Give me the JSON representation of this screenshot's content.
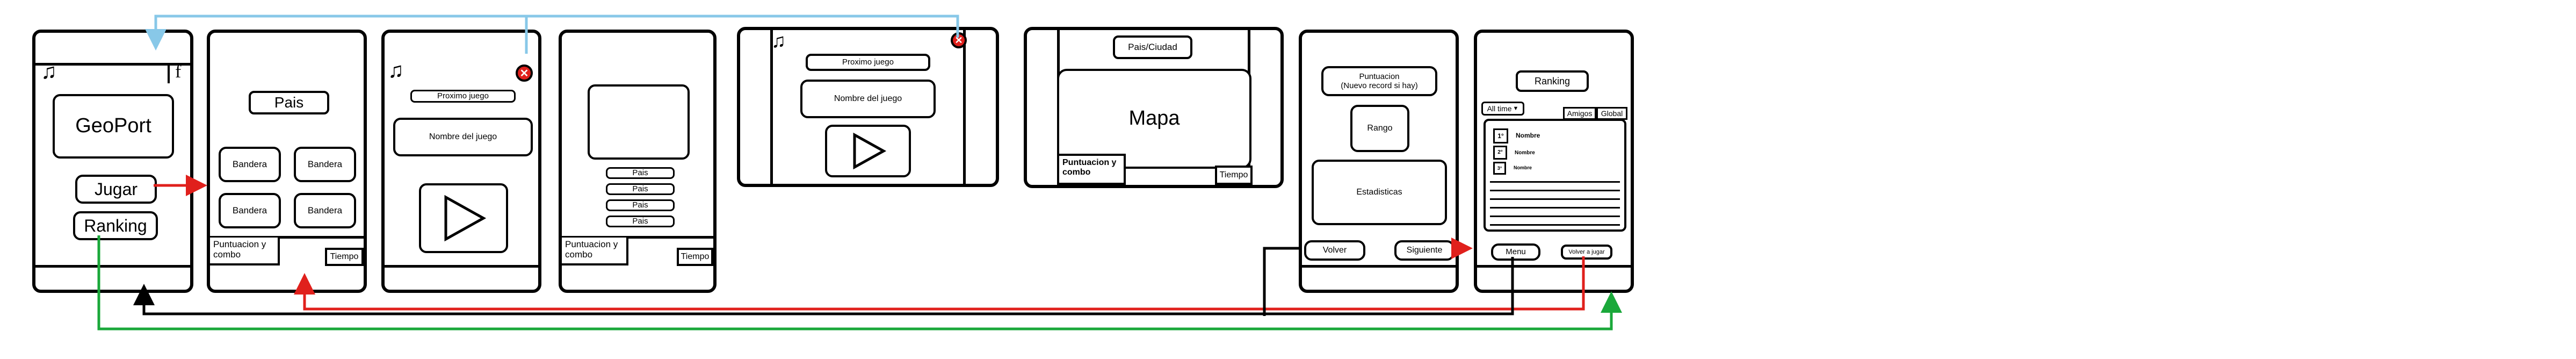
{
  "colors": {
    "blue": "#88c8e8",
    "red": "#e0201c",
    "green": "#1aa83a",
    "black": "#000000"
  },
  "icons": [
    "music-note-icon",
    "facebook-icon",
    "close-icon",
    "play-icon",
    "arrow-down-icon"
  ],
  "s1": {
    "music": "♫",
    "fb": "f",
    "logo": "GeoPort",
    "play": "Jugar",
    "ranking": "Ranking"
  },
  "s2": {
    "country": "Pais",
    "flags": [
      "Bandera",
      "Bandera",
      "Bandera",
      "Bandera"
    ],
    "score": "Puntuacion y combo",
    "time": "Tiempo"
  },
  "s3": {
    "music": "♫",
    "close": "✕",
    "next": "Proximo juego",
    "game": "Nombre del juego",
    "play": "▶"
  },
  "s4": {
    "options": [
      "Pais",
      "Pais",
      "Pais",
      "Pais"
    ],
    "score": "Puntuacion y combo",
    "time": "Tiempo"
  },
  "s5": {
    "music": "♫",
    "close": "✕",
    "next": "Proximo juego",
    "game": "Nombre del juego",
    "play": "▶"
  },
  "s6": {
    "title": "Pais/Ciudad",
    "map": "Mapa",
    "score": "Puntuacion y combo",
    "time": "Tiempo"
  },
  "s7": {
    "score": "Puntuacion\n(Nuevo record si hay)",
    "rank": "Rango",
    "stats": "Estadisticas",
    "back": "Volver",
    "next": "Siguiente"
  },
  "s8": {
    "title": "Ranking",
    "filter": "All time",
    "tabs": [
      "Amigos",
      "Global"
    ],
    "entries": [
      {
        "pos": "1°",
        "name": "Nombre"
      },
      {
        "pos": "2°",
        "name": "Nombre"
      },
      {
        "pos": "3°",
        "name": "Nombre"
      }
    ],
    "menu": "Menu",
    "again": "Volver a jugar"
  }
}
